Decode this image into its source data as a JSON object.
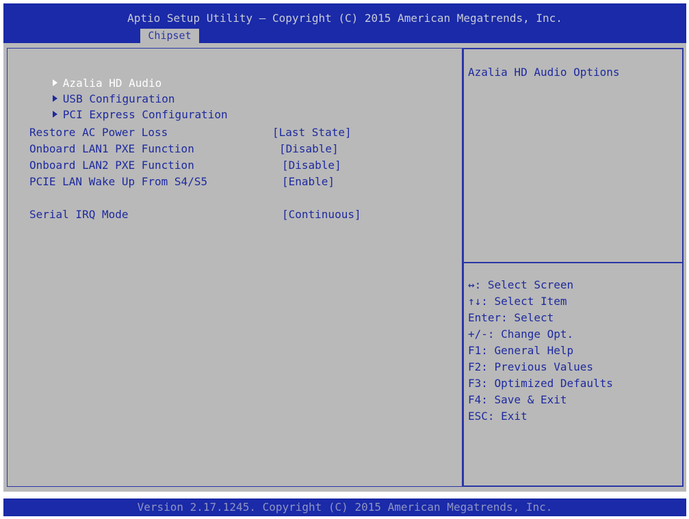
{
  "header": {
    "title": "Aptio Setup Utility – Copyright (C) 2015 American Megatrends, Inc.",
    "active_tab": "Chipset"
  },
  "menu": {
    "submenus": [
      {
        "label": "Azalia HD Audio",
        "selected": true
      },
      {
        "label": "USB Configuration",
        "selected": false
      },
      {
        "label": "PCI Express Configuration",
        "selected": false
      }
    ],
    "settings": [
      {
        "label": "Restore AC Power Loss",
        "value": "[Last State]"
      },
      {
        "label": "Onboard LAN1 PXE Function",
        "value": "[Disable]"
      },
      {
        "label": "Onboard LAN2 PXE Function",
        "value": "[Disable]"
      },
      {
        "label": "PCIE LAN Wake Up From S4/S5",
        "value": "[Enable]"
      },
      {
        "label": "Serial IRQ Mode",
        "value": "[Continuous]"
      }
    ]
  },
  "help": {
    "description": "Azalia HD Audio Options",
    "keys": [
      "↔: Select Screen",
      "↑↓: Select Item",
      "Enter: Select",
      "+/-: Change Opt.",
      "F1: General Help",
      "F2: Previous Values",
      "F3: Optimized Defaults",
      "F4: Save & Exit",
      "ESC: Exit"
    ]
  },
  "footer": {
    "text": "Version 2.17.1245. Copyright (C) 2015 American Megatrends, Inc."
  },
  "colors": {
    "header_background": "#1a2aa8",
    "panel_background": "#b9b9b9",
    "text": "#1e2a9e",
    "selected_text": "#ffffff"
  }
}
